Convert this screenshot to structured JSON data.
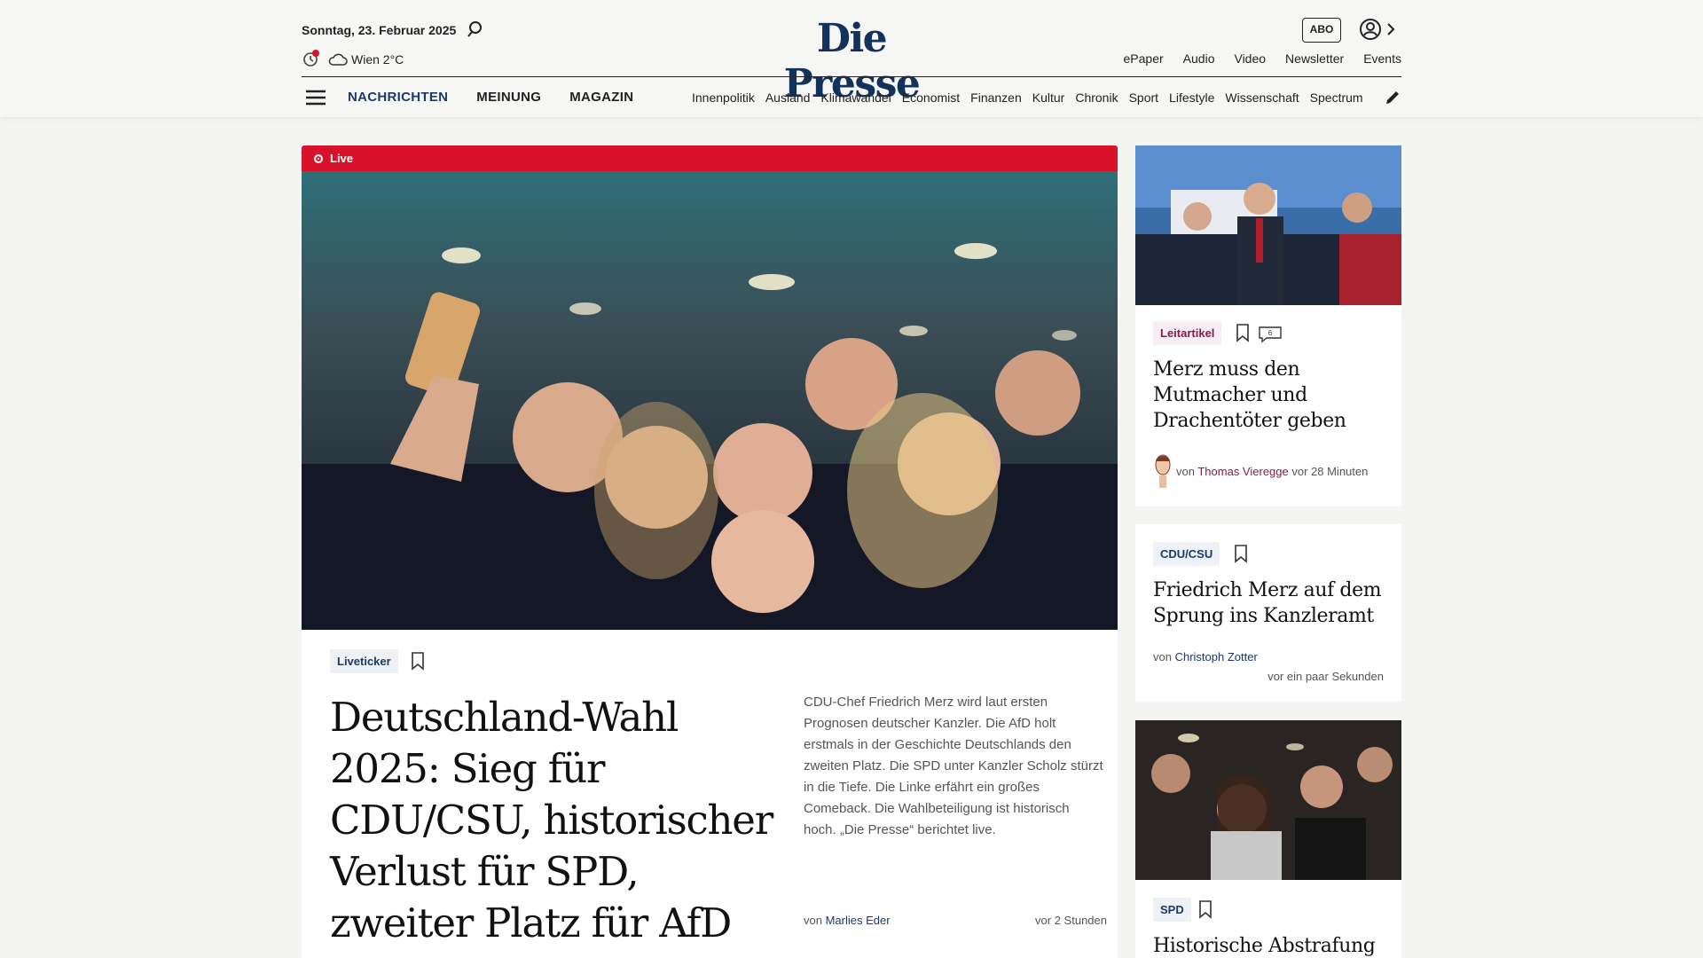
{
  "header": {
    "date": "Sonntag, 23. Februar 2025",
    "weather": "Wien 2°C",
    "logo": "Die Presse",
    "abo": "ABO",
    "quicklinks": [
      "ePaper",
      "Audio",
      "Video",
      "Newsletter",
      "Events"
    ]
  },
  "nav": {
    "main": [
      "NACHRICHTEN",
      "MEINUNG",
      "MAGAZIN"
    ],
    "sub": [
      "Innenpolitik",
      "Ausland",
      "Klimawandel",
      "Economist",
      "Finanzen",
      "Kultur",
      "Chronik",
      "Sport",
      "Lifestyle",
      "Wissenschaft",
      "Spectrum"
    ]
  },
  "main_article": {
    "live_label": "Live",
    "tag": "Liveticker",
    "headline": "Deutschland-Wahl 2025: Sieg für CDU/CSU, historischer Verlust für SPD, zweiter Platz für AfD",
    "teaser": "CDU-Chef Friedrich Merz wird laut ersten Prognosen deutscher Kanzler. Die AfD holt erstmals in der Geschichte Deutschlands den zweiten Platz. Die SPD unter Kanzler Scholz stürzt in die Tiefe. Die Linke erfährt ein großes Comeback. Die Wahlbeteiligung ist historisch hoch. „Die Presse“ berichtet live.",
    "by": "von",
    "author": "Marlies Eder",
    "time": "vor 2 Stunden"
  },
  "side1": {
    "tag": "Leitartikel",
    "comments": "6",
    "headline": "Merz muss den Mutmacher und Drachentöter geben",
    "by": "von",
    "author": "Thomas Vieregge",
    "time": "vor 28 Minuten"
  },
  "side2": {
    "tag": "CDU/CSU",
    "headline": "Friedrich Merz auf dem Sprung ins Kanzleramt",
    "by": "von",
    "author": "Christoph Zotter",
    "time": "vor ein paar Sekunden"
  },
  "side3": {
    "tag": "SPD",
    "headline": "Historische Abstrafung"
  },
  "colors": {
    "brand": "#13325b",
    "live": "#d8122a",
    "leitartikel": "#8a1b4b"
  }
}
